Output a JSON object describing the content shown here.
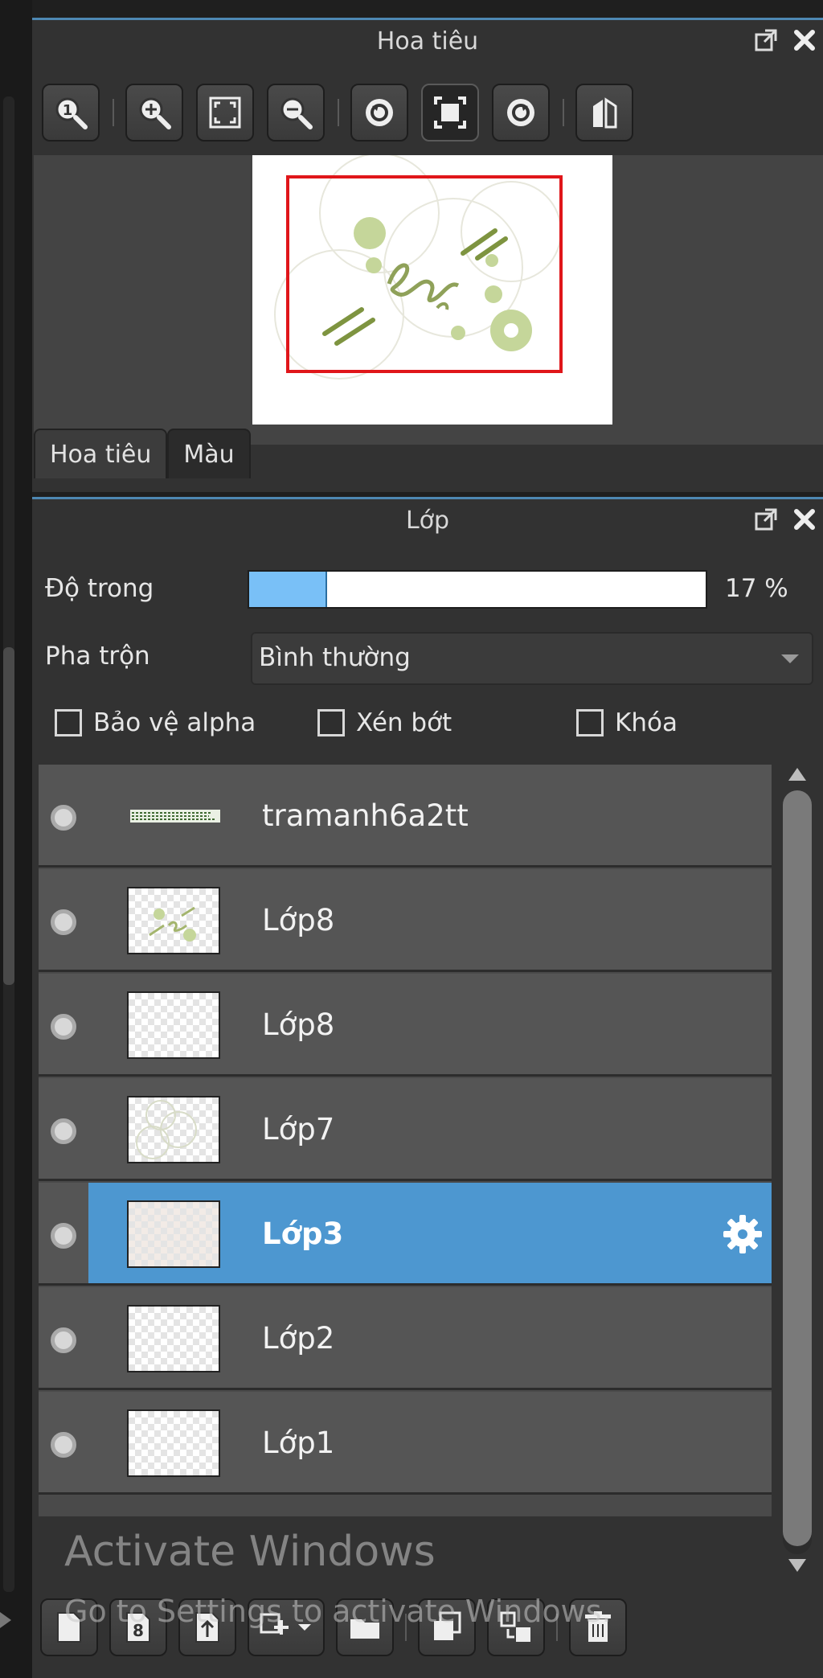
{
  "navigator": {
    "title": "Hoa tiêu",
    "tabs": [
      {
        "label": "Hoa tiêu",
        "active": true
      },
      {
        "label": "Màu",
        "active": false
      }
    ],
    "toolbar": [
      "zoom-reset-icon",
      "zoom-in-icon",
      "fit-screen-icon",
      "zoom-out-icon",
      "rotate-left-icon",
      "fit-canvas-icon",
      "rotate-right-icon",
      "flip-icon"
    ]
  },
  "layers_panel": {
    "title": "Lớp",
    "opacity_label": "Độ trong",
    "opacity_value": "17 %",
    "opacity_fraction": 0.17,
    "blend_label": "Pha trộn",
    "blend_value": "Bình thường",
    "checkboxes": {
      "protect_alpha": "Bảo vệ alpha",
      "clipping": "Xén bớt",
      "lock": "Khóa"
    },
    "layers": [
      {
        "name": "tramanh6a2tt",
        "selected": false
      },
      {
        "name": "Lớp8",
        "selected": false
      },
      {
        "name": "Lớp8",
        "selected": false
      },
      {
        "name": "Lớp7",
        "selected": false
      },
      {
        "name": "Lớp3",
        "selected": true
      },
      {
        "name": "Lớp2",
        "selected": false
      },
      {
        "name": "Lớp1",
        "selected": false
      }
    ]
  },
  "watermark": {
    "title": "Activate Windows",
    "subtitle": "Go to Settings to activate Windows."
  },
  "colors": {
    "accent": "#4d97d0",
    "slider_fill": "#79c0f7",
    "nav_rect": "#e0161a"
  }
}
